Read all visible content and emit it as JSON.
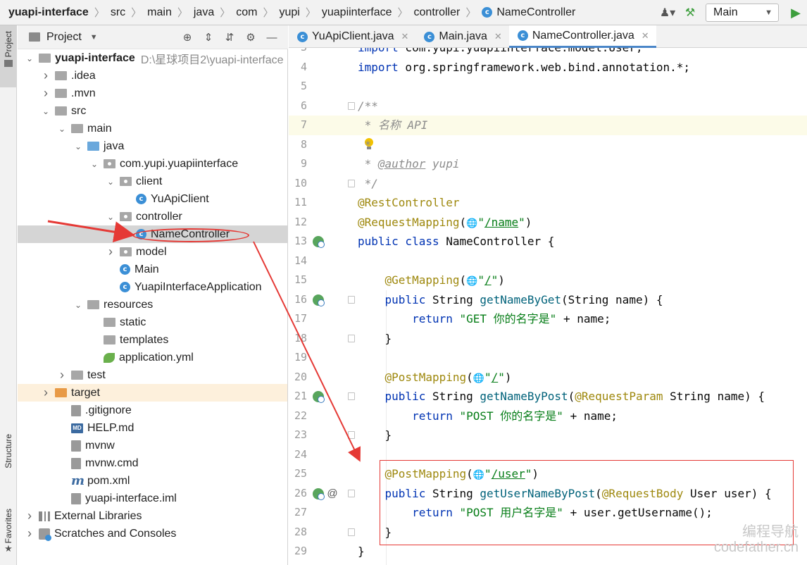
{
  "breadcrumbs": [
    "yuapi-interface",
    "src",
    "main",
    "java",
    "com",
    "yupi",
    "yuapiinterface",
    "controller",
    "NameController"
  ],
  "run_config": "Main",
  "stripe": {
    "project": "Project",
    "structure": "Structure",
    "favorites": "Favorites"
  },
  "project_panel": {
    "title": "Project"
  },
  "tree": [
    {
      "label": "yuapi-interface",
      "hint": "D:\\星球项目2\\yuapi-interface",
      "depth": 0,
      "arrow": "down",
      "icon": "folder",
      "bold": true
    },
    {
      "label": ".idea",
      "depth": 1,
      "arrow": "right",
      "icon": "folder"
    },
    {
      "label": ".mvn",
      "depth": 1,
      "arrow": "right",
      "icon": "folder"
    },
    {
      "label": "src",
      "depth": 1,
      "arrow": "down",
      "icon": "folder"
    },
    {
      "label": "main",
      "depth": 2,
      "arrow": "down",
      "icon": "folder"
    },
    {
      "label": "java",
      "depth": 3,
      "arrow": "down",
      "icon": "folder-blue"
    },
    {
      "label": "com.yupi.yuapiinterface",
      "depth": 4,
      "arrow": "down",
      "icon": "package"
    },
    {
      "label": "client",
      "depth": 5,
      "arrow": "down",
      "icon": "package"
    },
    {
      "label": "YuApiClient",
      "depth": 6,
      "arrow": "none",
      "icon": "class"
    },
    {
      "label": "controller",
      "depth": 5,
      "arrow": "down",
      "icon": "package"
    },
    {
      "label": "NameController",
      "depth": 6,
      "arrow": "none",
      "icon": "class",
      "selected": true
    },
    {
      "label": "model",
      "depth": 5,
      "arrow": "right",
      "icon": "package"
    },
    {
      "label": "Main",
      "depth": 5,
      "arrow": "none",
      "icon": "class"
    },
    {
      "label": "YuapiInterfaceApplication",
      "depth": 5,
      "arrow": "none",
      "icon": "class"
    },
    {
      "label": "resources",
      "depth": 3,
      "arrow": "down",
      "icon": "folder"
    },
    {
      "label": "static",
      "depth": 4,
      "arrow": "none",
      "icon": "folder"
    },
    {
      "label": "templates",
      "depth": 4,
      "arrow": "none",
      "icon": "folder"
    },
    {
      "label": "application.yml",
      "depth": 4,
      "arrow": "none",
      "icon": "leaf"
    },
    {
      "label": "test",
      "depth": 2,
      "arrow": "right",
      "icon": "folder"
    },
    {
      "label": "target",
      "depth": 1,
      "arrow": "right",
      "icon": "folder-orange",
      "target": true
    },
    {
      "label": ".gitignore",
      "depth": 2,
      "arrow": "none",
      "icon": "file"
    },
    {
      "label": "HELP.md",
      "depth": 2,
      "arrow": "none",
      "icon": "md"
    },
    {
      "label": "mvnw",
      "depth": 2,
      "arrow": "none",
      "icon": "file"
    },
    {
      "label": "mvnw.cmd",
      "depth": 2,
      "arrow": "none",
      "icon": "file"
    },
    {
      "label": "pom.xml",
      "depth": 2,
      "arrow": "none",
      "icon": "maven"
    },
    {
      "label": "yuapi-interface.iml",
      "depth": 2,
      "arrow": "none",
      "icon": "file"
    },
    {
      "label": "External Libraries",
      "depth": 0,
      "arrow": "right",
      "icon": "library"
    },
    {
      "label": "Scratches and Consoles",
      "depth": 0,
      "arrow": "right",
      "icon": "scratch"
    }
  ],
  "tabs": [
    {
      "label": "YuApiClient.java",
      "active": false
    },
    {
      "label": "Main.java",
      "active": false
    },
    {
      "label": "NameController.java",
      "active": true
    }
  ],
  "code_lines": [
    {
      "n": "3",
      "html": "<span class=\"kw\">import</span> com.yupi.yuapiinterface.model.User;",
      "partial": true
    },
    {
      "n": "4",
      "html": "<span class=\"kw\">import</span> org.springframework.web.bind.annotation.*;"
    },
    {
      "n": "5",
      "html": ""
    },
    {
      "n": "6",
      "html": "<span class=\"cmt\">/**</span>",
      "fold": true
    },
    {
      "n": "7",
      "html": "<span class=\"cmt\"> * 名称 API</span>",
      "highlight": true
    },
    {
      "n": "8",
      "html": "<span class=\"cmt\"> *</span>",
      "bulb": true
    },
    {
      "n": "9",
      "html": "<span class=\"cmt\"> * </span><span class=\"tag\">@author</span><span class=\"cmt\"> yupi</span>"
    },
    {
      "n": "10",
      "html": "<span class=\"cmt\"> */</span>",
      "fold": true
    },
    {
      "n": "11",
      "html": "<span class=\"ann\">@RestController</span>"
    },
    {
      "n": "12",
      "html": "<span class=\"ann\">@RequestMapping</span>(<span class=\"globe\">🌐</span><span class=\"str\">\"<span class=\"u\">/name</span>\"</span>)"
    },
    {
      "n": "13",
      "html": "<span class=\"kw\">public class</span> NameController {",
      "bean": true
    },
    {
      "n": "14",
      "html": ""
    },
    {
      "n": "15",
      "html": "    <span class=\"ann\">@GetMapping</span>(<span class=\"globe\">🌐</span><span class=\"str\">\"<span class=\"u\">/</span>\"</span>)"
    },
    {
      "n": "16",
      "html": "    <span class=\"kw\">public</span> String <span class=\"fn\">getNameByGet</span>(String name) {",
      "bean": true,
      "fold": true
    },
    {
      "n": "17",
      "html": "        <span class=\"kw\">return</span> <span class=\"str\">\"GET 你的名字是\"</span> + name;"
    },
    {
      "n": "18",
      "html": "    }",
      "fold": true
    },
    {
      "n": "19",
      "html": ""
    },
    {
      "n": "20",
      "html": "    <span class=\"ann\">@PostMapping</span>(<span class=\"globe\">🌐</span><span class=\"str\">\"<span class=\"u\">/</span>\"</span>)"
    },
    {
      "n": "21",
      "html": "    <span class=\"kw\">public</span> String <span class=\"fn\">getNameByPost</span>(<span class=\"ann\">@RequestParam</span> String name) {",
      "bean": true,
      "fold": true
    },
    {
      "n": "22",
      "html": "        <span class=\"kw\">return</span> <span class=\"str\">\"POST 你的名字是\"</span> + name;"
    },
    {
      "n": "23",
      "html": "    }",
      "fold": true
    },
    {
      "n": "24",
      "html": ""
    },
    {
      "n": "25",
      "html": "    <span class=\"ann\">@PostMapping</span>(<span class=\"globe\">🌐</span><span class=\"str\">\"<span class=\"u\">/user</span>\"</span>)"
    },
    {
      "n": "26",
      "html": "    <span class=\"kw\">public</span> String <span class=\"fn\">getUserNameByPost</span>(<span class=\"ann\">@RequestBody</span> User user) {",
      "bean": true,
      "at": true,
      "fold": true
    },
    {
      "n": "27",
      "html": "        <span class=\"kw\">return</span> <span class=\"str\">\"POST 用户名字是\"</span> + user.getUsername();"
    },
    {
      "n": "28",
      "html": "    }",
      "fold": true
    },
    {
      "n": "29",
      "html": "}"
    }
  ],
  "watermark": {
    "line1": "编程导航",
    "line2": "codefather.cn"
  },
  "colors": {
    "accent": "#4a86c8",
    "annotation_red": "#e53935",
    "selection": "#d5d5d5"
  }
}
